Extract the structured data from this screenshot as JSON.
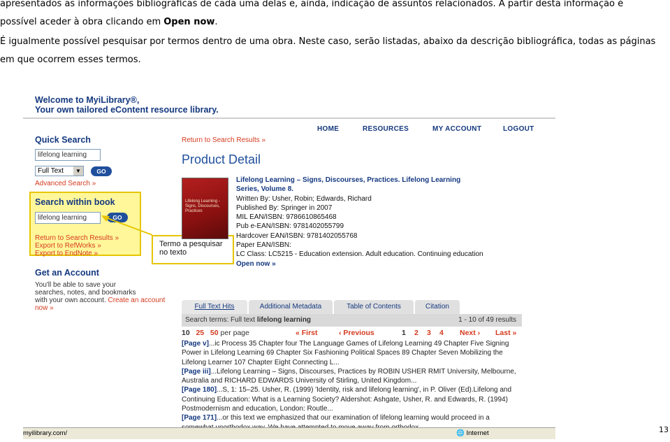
{
  "doc": {
    "para1_line1": "apresentados as informações bibliográficas de cada uma delas e, ainda, indicação de assuntos relacionados. A partir desta informação é",
    "para1_line2_pre": "possível aceder à obra clicando em ",
    "para1_line2_bold": "Open now",
    "para1_line2_post": ".",
    "para2_line1": "É igualmente possível pesquisar por termos dentro de uma obra. Neste caso, serão listadas, abaixo da descrição bibliográfica, todas as páginas",
    "para2_line2": "em que ocorrem esses termos.",
    "page_number": "13"
  },
  "screenshot": {
    "welcome_line1": "Welcome to MyiLibrary®,",
    "welcome_line2": "Your own tailored eContent resource library.",
    "nav": [
      "HOME",
      "RESOURCES",
      "MY ACCOUNT",
      "LOGOUT"
    ],
    "sidebar": {
      "quick_search_title": "Quick Search",
      "quick_search_value": "lifelong learning",
      "select_value": "Full Text",
      "go_label": "GO",
      "advanced_search": "Advanced Search »",
      "search_within_title": "Search within book",
      "search_within_value": "lifelong learning",
      "links": [
        "Return to Search Results »",
        "Export to RefWorks »",
        "Export to EndNote »"
      ],
      "account_title": "Get an Account",
      "account_text_1": "You'll be able to save your",
      "account_text_2": "searches, notes, and bookmarks",
      "account_text_3": "with your own account.",
      "create_now": "Create an account now »"
    },
    "callout": "Termo a pesquisar no texto",
    "main": {
      "return_link": "Return to Search Results »",
      "product_detail": "Product Detail",
      "cover_text": "Lifelong Learning - Signs, Discourses, Practices",
      "book_title_1": "Lifelong Learning – Signs, Discourses, Practices. Lifelong Learning",
      "book_title_2": "Series, Volume 8.",
      "written_by": "Written By: Usher, Robin; Edwards, Richard",
      "published_by": "Published By: Springer in 2007",
      "mil_ean": "MIL EAN/ISBN: 9786610865468",
      "pub_ean": "Pub e-EAN/ISBN: 9781402055799",
      "hardcover_ean": "Hardcover EAN/ISBN: 9781402055768",
      "paper_ean": "Paper EAN/ISBN:",
      "lc_class": "LC Class: LC5215 - Education extension. Adult education. Continuing education",
      "open_now": "Open now »",
      "tabs": [
        "Full Text Hits",
        "Additional Metadata",
        "Table of Contents",
        "Citation"
      ],
      "search_terms_label": "Search terms: Full text ",
      "search_terms_value": "lifelong learning",
      "results_count": "1 - 10 of 49 results",
      "per_page": [
        "10",
        "25",
        "50",
        "per page"
      ],
      "first": "« First",
      "previous": "‹ Previous",
      "pages": [
        "1",
        "2",
        "3",
        "4"
      ],
      "next": "Next ›",
      "last": "Last »",
      "results": [
        {
          "page": "[Page v]",
          "text": "...ic Process 35 Chapter four The Language Games of Lifelong Learning 49 Chapter Five Signing Power in Lifelong Learning 69 Chapter Six Fashioning Political Spaces 89 Chapter Seven Mobilizing the Lifelong Learner 107 Chapter Eight Connecting L..."
        },
        {
          "page": "[Page iii]",
          "text": "...Lifelong Learning – Signs, Discourses, Practices by ROBIN USHER RMIT University, Melbourne, Australia and RICHARD EDWARDS University of Stirling, United Kingdom..."
        },
        {
          "page": "[Page 180]",
          "text": "...S, 1: 15–25. Usher, R. (1999) 'Identity, risk and lifelong learning', in P. Oliver (Ed).Lifelong and Continuing Education: What is a Learning Society? Aldershot: Ashgate, Usher, R. and Edwards, R. (1994) Postmodernism and education, London: Routle..."
        },
        {
          "page": "[Page 171]",
          "text": "...or this text we emphasized that our examination of lifelong learning would proceed in a somewhat unorthodox way. We have attempted to move away from orthodox"
        }
      ]
    },
    "status_url": "myilibrary.com/",
    "status_zone": "Internet"
  }
}
